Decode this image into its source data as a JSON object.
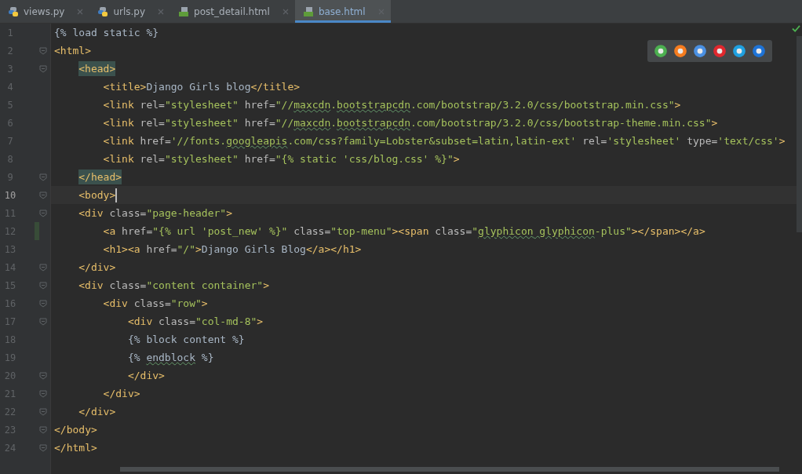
{
  "tabs": [
    {
      "label": "views.py",
      "kind": "python",
      "selected": false
    },
    {
      "label": "urls.py",
      "kind": "python",
      "selected": false
    },
    {
      "label": "post_detail.html",
      "kind": "html",
      "selected": false
    },
    {
      "label": "base.html",
      "kind": "html",
      "selected": true
    }
  ],
  "lines": [
    {
      "number": "1",
      "fold": false,
      "current": false,
      "changed": false,
      "tokens": [
        {
          "kind": "tpl",
          "text": "{% load static %}"
        }
      ]
    },
    {
      "number": "2",
      "fold": true,
      "current": false,
      "changed": false,
      "tokens": [
        {
          "kind": "tag",
          "text": "<html>"
        }
      ],
      "children": [
        {
          "number": "3",
          "fold": true,
          "current": false,
          "changed": false,
          "tokens": [
            {
              "kind": "match",
              "text": "<head>"
            }
          ],
          "children": [
            {
              "number": "4",
              "fold": false,
              "current": false,
              "changed": false,
              "tokens": [
                {
                  "kind": "tag",
                  "text": "<title>"
                },
                {
                  "kind": "text",
                  "text": "Django Girls blog"
                },
                {
                  "kind": "tag",
                  "text": "</title>"
                }
              ]
            },
            {
              "number": "5",
              "fold": false,
              "current": false,
              "changed": false,
              "tokens": [
                {
                  "kind": "tag",
                  "text": "<link"
                },
                {
                  "kind": "attr",
                  "text": " rel="
                },
                {
                  "kind": "str",
                  "text": "\"stylesheet\""
                },
                {
                  "kind": "attr",
                  "text": " href="
                },
                {
                  "kind": "str",
                  "text": "\"//"
                },
                {
                  "kind": "str-typo",
                  "text": "maxcdn"
                },
                {
                  "kind": "str",
                  "text": "."
                },
                {
                  "kind": "str-typo",
                  "text": "bootstrapcdn"
                },
                {
                  "kind": "str",
                  "text": ".com/bootstrap/3.2.0/css/bootstrap.min.css\""
                },
                {
                  "kind": "tag",
                  "text": ">"
                }
              ]
            },
            {
              "number": "6",
              "fold": false,
              "current": false,
              "changed": false,
              "tokens": [
                {
                  "kind": "tag",
                  "text": "<link"
                },
                {
                  "kind": "attr",
                  "text": " rel="
                },
                {
                  "kind": "str",
                  "text": "\"stylesheet\""
                },
                {
                  "kind": "attr",
                  "text": " href="
                },
                {
                  "kind": "str",
                  "text": "\"//"
                },
                {
                  "kind": "str-typo",
                  "text": "maxcdn"
                },
                {
                  "kind": "str",
                  "text": "."
                },
                {
                  "kind": "str-typo",
                  "text": "bootstrapcdn"
                },
                {
                  "kind": "str",
                  "text": ".com/bootstrap/3.2.0/css/bootstrap-theme.min.css\""
                },
                {
                  "kind": "tag",
                  "text": ">"
                }
              ]
            },
            {
              "number": "7",
              "fold": false,
              "current": false,
              "changed": false,
              "tokens": [
                {
                  "kind": "tag",
                  "text": "<link"
                },
                {
                  "kind": "attr",
                  "text": " href="
                },
                {
                  "kind": "str",
                  "text": "'//fonts."
                },
                {
                  "kind": "str-typo",
                  "text": "googleapis"
                },
                {
                  "kind": "str",
                  "text": ".com/css?family=Lobster&subset=latin,latin-ext'"
                },
                {
                  "kind": "attr",
                  "text": " rel="
                },
                {
                  "kind": "str",
                  "text": "'stylesheet'"
                },
                {
                  "kind": "attr",
                  "text": " type="
                },
                {
                  "kind": "str",
                  "text": "'text/css'"
                },
                {
                  "kind": "tag",
                  "text": ">"
                }
              ]
            },
            {
              "number": "8",
              "fold": false,
              "current": false,
              "changed": false,
              "tokens": [
                {
                  "kind": "tag",
                  "text": "<link"
                },
                {
                  "kind": "attr",
                  "text": " rel="
                },
                {
                  "kind": "str",
                  "text": "\"stylesheet\""
                },
                {
                  "kind": "attr",
                  "text": " href="
                },
                {
                  "kind": "str",
                  "text": "\"{% static 'css/blog.css' %}\""
                },
                {
                  "kind": "tag",
                  "text": ">"
                }
              ]
            }
          ]
        },
        {
          "number": "9",
          "fold": true,
          "current": false,
          "changed": false,
          "tokens": [
            {
              "kind": "match",
              "text": "</head>"
            }
          ]
        },
        {
          "number": "10",
          "fold": true,
          "current": true,
          "changed": false,
          "tokens": [
            {
              "kind": "tag",
              "text": "<body>"
            }
          ]
        },
        {
          "number": "11",
          "fold": true,
          "current": false,
          "changed": false,
          "tokens": [
            {
              "kind": "tag",
              "text": "<div"
            },
            {
              "kind": "attr",
              "text": " class="
            },
            {
              "kind": "str",
              "text": "\"page-header\""
            },
            {
              "kind": "tag",
              "text": ">"
            }
          ],
          "children": [
            {
              "number": "12",
              "fold": false,
              "current": false,
              "changed": true,
              "tokens": [
                {
                  "kind": "tag",
                  "text": "<a"
                },
                {
                  "kind": "attr",
                  "text": " href="
                },
                {
                  "kind": "str",
                  "text": "\"{% url 'post_new' %}\""
                },
                {
                  "kind": "attr",
                  "text": " class="
                },
                {
                  "kind": "str",
                  "text": "\"top-menu\""
                },
                {
                  "kind": "tag",
                  "text": "><span"
                },
                {
                  "kind": "attr",
                  "text": " class="
                },
                {
                  "kind": "str",
                  "text": "\""
                },
                {
                  "kind": "str-typo",
                  "text": "glyphicon"
                },
                {
                  "kind": "str-typo",
                  "text": " glyphicon"
                },
                {
                  "kind": "str",
                  "text": "-plus\""
                },
                {
                  "kind": "tag",
                  "text": "></span></a>"
                }
              ]
            },
            {
              "number": "13",
              "fold": false,
              "current": false,
              "changed": false,
              "tokens": [
                {
                  "kind": "tag",
                  "text": "<h1><a"
                },
                {
                  "kind": "attr",
                  "text": " href="
                },
                {
                  "kind": "str",
                  "text": "\"/\""
                },
                {
                  "kind": "tag",
                  "text": ">"
                },
                {
                  "kind": "text",
                  "text": "Django Girls Blog"
                },
                {
                  "kind": "tag",
                  "text": "</a></h1>"
                }
              ]
            }
          ]
        },
        {
          "number": "14",
          "fold": true,
          "current": false,
          "changed": false,
          "tokens": [
            {
              "kind": "tag",
              "text": "</div>"
            }
          ]
        },
        {
          "number": "15",
          "fold": true,
          "current": false,
          "changed": false,
          "tokens": [
            {
              "kind": "tag",
              "text": "<div"
            },
            {
              "kind": "attr",
              "text": " class="
            },
            {
              "kind": "str",
              "text": "\"content container\""
            },
            {
              "kind": "tag",
              "text": ">"
            }
          ],
          "children": [
            {
              "number": "16",
              "fold": true,
              "current": false,
              "changed": false,
              "tokens": [
                {
                  "kind": "tag",
                  "text": "<div"
                },
                {
                  "kind": "attr",
                  "text": " class="
                },
                {
                  "kind": "str",
                  "text": "\"row\""
                },
                {
                  "kind": "tag",
                  "text": ">"
                }
              ],
              "children": [
                {
                  "number": "17",
                  "fold": true,
                  "current": false,
                  "changed": false,
                  "tokens": [
                    {
                      "kind": "tag",
                      "text": "<div"
                    },
                    {
                      "kind": "attr",
                      "text": " class="
                    },
                    {
                      "kind": "str",
                      "text": "\"col-md-8\""
                    },
                    {
                      "kind": "tag",
                      "text": ">"
                    }
                  ]
                },
                {
                  "number": "18",
                  "fold": false,
                  "current": false,
                  "changed": false,
                  "tokens": [
                    {
                      "kind": "tpl",
                      "text": "{% block content %}"
                    }
                  ]
                },
                {
                  "number": "19",
                  "fold": false,
                  "current": false,
                  "changed": false,
                  "tokens": [
                    {
                      "kind": "tpl",
                      "text": "{% "
                    },
                    {
                      "kind": "tpl-typo",
                      "text": "endblock"
                    },
                    {
                      "kind": "tpl",
                      "text": " %}"
                    }
                  ]
                },
                {
                  "number": "20",
                  "fold": true,
                  "current": false,
                  "changed": false,
                  "tokens": [
                    {
                      "kind": "tag",
                      "text": "</div>"
                    }
                  ]
                }
              ]
            },
            {
              "number": "21",
              "fold": true,
              "current": false,
              "changed": false,
              "tokens": [
                {
                  "kind": "tag",
                  "text": "</div>"
                }
              ]
            }
          ]
        },
        {
          "number": "22",
          "fold": true,
          "current": false,
          "changed": false,
          "tokens": [
            {
              "kind": "tag",
              "text": "</div>"
            }
          ]
        }
      ]
    },
    {
      "number": "23",
      "fold": true,
      "current": false,
      "changed": false,
      "tokens": [
        {
          "kind": "tag",
          "text": "</body>"
        }
      ]
    },
    {
      "number": "24",
      "fold": true,
      "current": false,
      "changed": false,
      "tokens": [
        {
          "kind": "tag",
          "text": "</html>"
        }
      ]
    }
  ],
  "browsers": [
    {
      "color": "#4caf50"
    },
    {
      "color": "#f57c1f"
    },
    {
      "color": "#4a90e2"
    },
    {
      "color": "#e0282e"
    },
    {
      "color": "#1fa0e0"
    },
    {
      "color": "#1e73d6"
    }
  ]
}
